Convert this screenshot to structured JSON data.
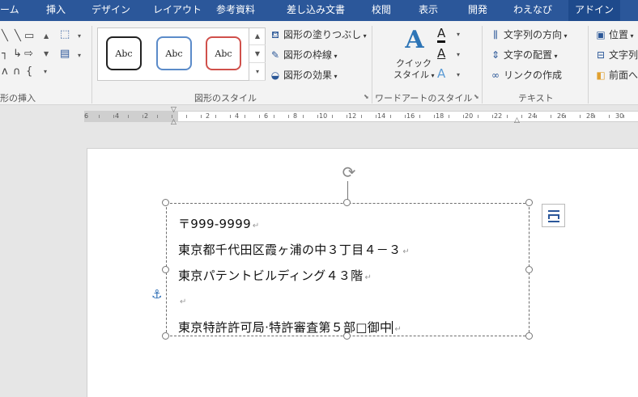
{
  "tabs": [
    "ーム",
    "挿入",
    "デザイン",
    "レイアウト",
    "参考資料",
    "差し込み文書",
    "校閲",
    "表示",
    "開発",
    "わえなび",
    "アドイン"
  ],
  "ribbon": {
    "groups": {
      "insert_shapes": "形の挿入",
      "shape_styles": "図形のスタイル",
      "wordart_styles": "ワードアートのスタイル",
      "text": "テキスト"
    },
    "style_samples": [
      "Abc",
      "Abc",
      "Abc"
    ],
    "shape_commands": {
      "fill": "図形の塗りつぶし",
      "outline": "図形の枠線",
      "effects": "図形の効果"
    },
    "quick_style": {
      "line1": "クイック",
      "line2": "スタイル"
    },
    "text_commands": {
      "direction": "文字列の方向",
      "align": "文字の配置",
      "link": "リンクの作成"
    },
    "arrange_commands": {
      "position": "位置",
      "wrap": "文字列",
      "front": "前面へ"
    }
  },
  "ruler": {
    "labels": [
      "6",
      "4",
      "2",
      "2",
      "4",
      "6",
      "8",
      "10",
      "12",
      "14",
      "16",
      "18",
      "20",
      "22",
      "24",
      "26",
      "28",
      "30"
    ]
  },
  "document": {
    "lines": [
      "〒999-9999",
      "東京都千代田区霞ヶ浦の中３丁目４－３",
      "東京パテントビルディング４３階",
      "",
      "東京特許許可局·特許審査第５部□御中"
    ],
    "para_mark": "↵"
  }
}
